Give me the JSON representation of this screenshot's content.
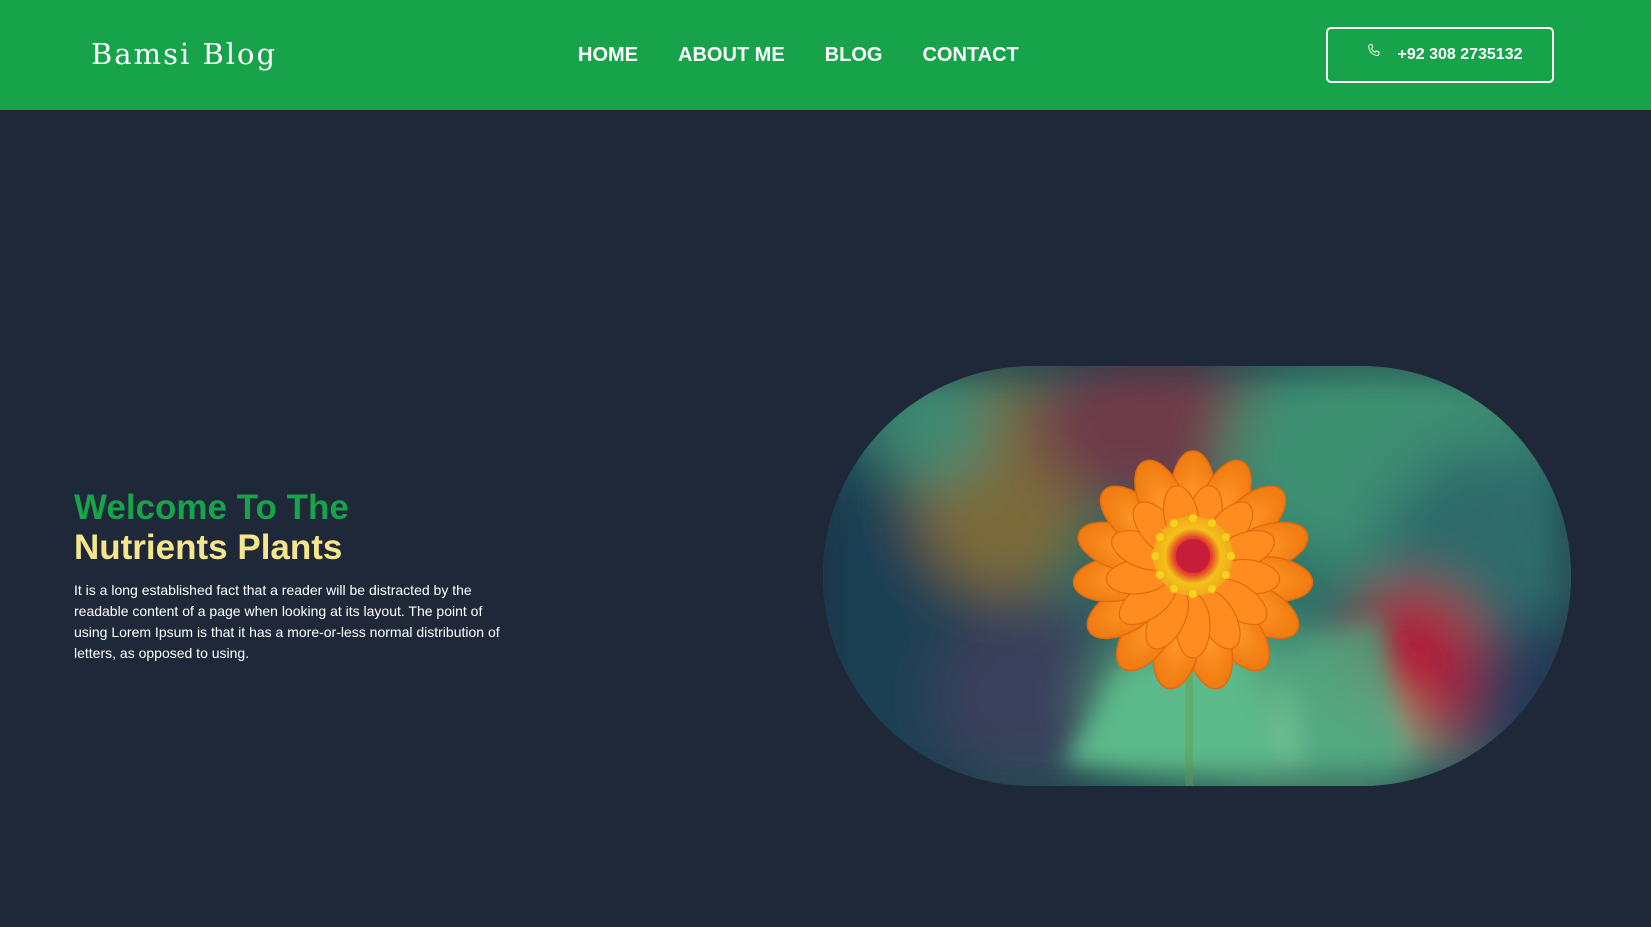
{
  "header": {
    "brand": "Bamsi Blog",
    "nav": [
      {
        "label": "HOME"
      },
      {
        "label": "ABOUT ME"
      },
      {
        "label": "BLOG"
      },
      {
        "label": "CONTACT"
      }
    ],
    "phone": {
      "icon": "phone-icon",
      "number": "+92 308 2735132"
    }
  },
  "hero": {
    "title_line1": "Welcome To The",
    "title_line2": "Nutrients Plants",
    "description": "It is a long established fact that a reader will be distracted by the readable content of a page when looking at its layout. The point of using Lorem Ipsum is that it has a more-or-less normal distribution of letters, as opposed to using.",
    "image": "orange-zinnia-flower-photo"
  },
  "colors": {
    "brand_green": "#17a34a",
    "background": "#1f2838",
    "title_highlight": "#f6e58a",
    "text": "#ffffff"
  }
}
